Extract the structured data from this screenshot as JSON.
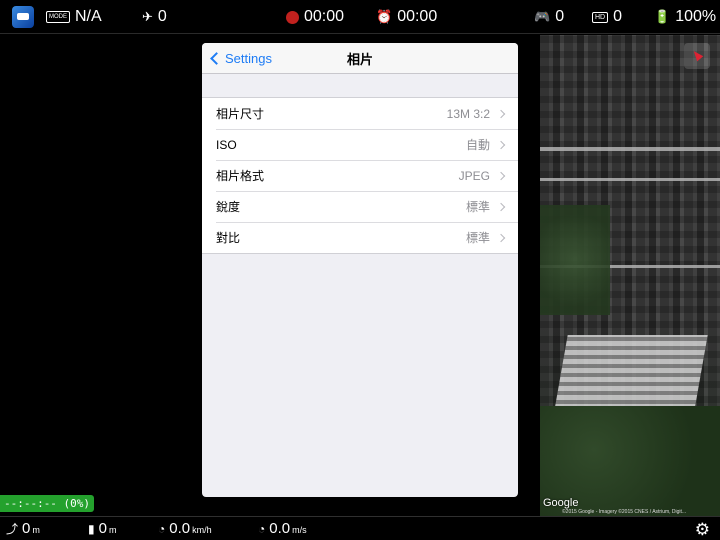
{
  "topbar": {
    "mode_icon": "MODE",
    "mode_value": "N/A",
    "satellite_count": "0",
    "recording_time": "00:00",
    "timer_time": "00:00",
    "controller_signal": "0",
    "hd_signal": "0",
    "battery": "100%",
    "icons": [
      "app-icon",
      "mode-icon",
      "satellite-icon",
      "record-dot-icon",
      "alarm-clock-icon",
      "remote-controller-icon",
      "hd-signal-icon",
      "battery-icon"
    ]
  },
  "settings": {
    "back_label": "Settings",
    "title": "相片",
    "rows": [
      {
        "label": "相片尺寸",
        "value": "13M 3:2"
      },
      {
        "label": "ISO",
        "value": "自動"
      },
      {
        "label": "相片格式",
        "value": "JPEG"
      },
      {
        "label": "銳度",
        "value": "標準"
      },
      {
        "label": "對比",
        "value": "標準"
      }
    ]
  },
  "map": {
    "logo": "Google",
    "credit": "©2015 Google - Imagery ©2015 CNES / Astrium, Digit..."
  },
  "storage": {
    "text": "--:--:-- (0%)",
    "color": "#24a12d"
  },
  "bottombar": {
    "distance": {
      "value": "0",
      "unit": "m"
    },
    "height": {
      "value": "0",
      "unit": "m"
    },
    "h_speed": {
      "value": "0.0",
      "unit": "km/h"
    },
    "v_speed": {
      "value": "0.0",
      "unit": "m/s"
    },
    "icons": [
      "distance-icon",
      "height-icon",
      "horizontal-speed-icon",
      "vertical-speed-icon",
      "gear-icon"
    ]
  },
  "colors": {
    "accent": "#1e7cf5",
    "record": "#c0211e"
  }
}
